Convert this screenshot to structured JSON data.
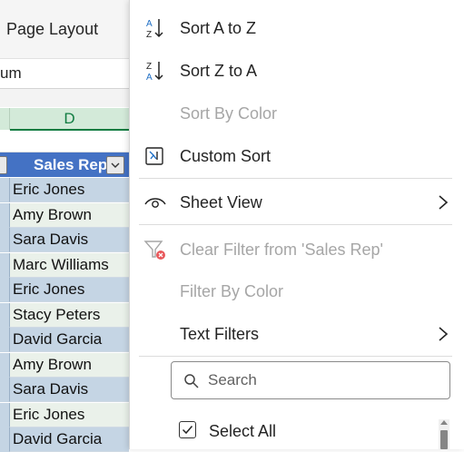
{
  "ribbon": {
    "tab_label": "Page Layout"
  },
  "formula_bar": {
    "value": "um"
  },
  "sheet": {
    "column_header": "D",
    "header_cell": "Sales Rep",
    "rows": [
      "Eric Jones",
      "Amy Brown",
      "Sara Davis",
      "Marc Williams",
      "Eric Jones",
      "Stacy Peters",
      "David Garcia",
      "Amy Brown",
      "Sara Davis",
      "Eric Jones",
      "David Garcia"
    ],
    "colors": {
      "header_fill": "#4472c4",
      "row_alt_a": "#c5d5e4",
      "row_alt_b": "#eaf1ea",
      "column_accent": "#107c41"
    }
  },
  "menu": {
    "sort_a_to_z": "Sort A to Z",
    "sort_z_to_a": "Sort Z to A",
    "sort_by_color": "Sort By Color",
    "custom_sort": "Custom Sort",
    "sheet_view": "Sheet View",
    "clear_filter": "Clear Filter from 'Sales Rep'",
    "filter_by_color": "Filter By Color",
    "text_filters": "Text Filters",
    "search_placeholder": "Search",
    "select_all": "Select All",
    "icons": {
      "sort_az": "sort-a-to-z-icon",
      "sort_za": "sort-z-to-a-icon",
      "custom_sort": "custom-sort-icon",
      "sheet_view": "eye-icon",
      "clear_filter": "clear-filter-icon",
      "search": "search-icon",
      "submenu": "chevron-right-icon"
    }
  }
}
